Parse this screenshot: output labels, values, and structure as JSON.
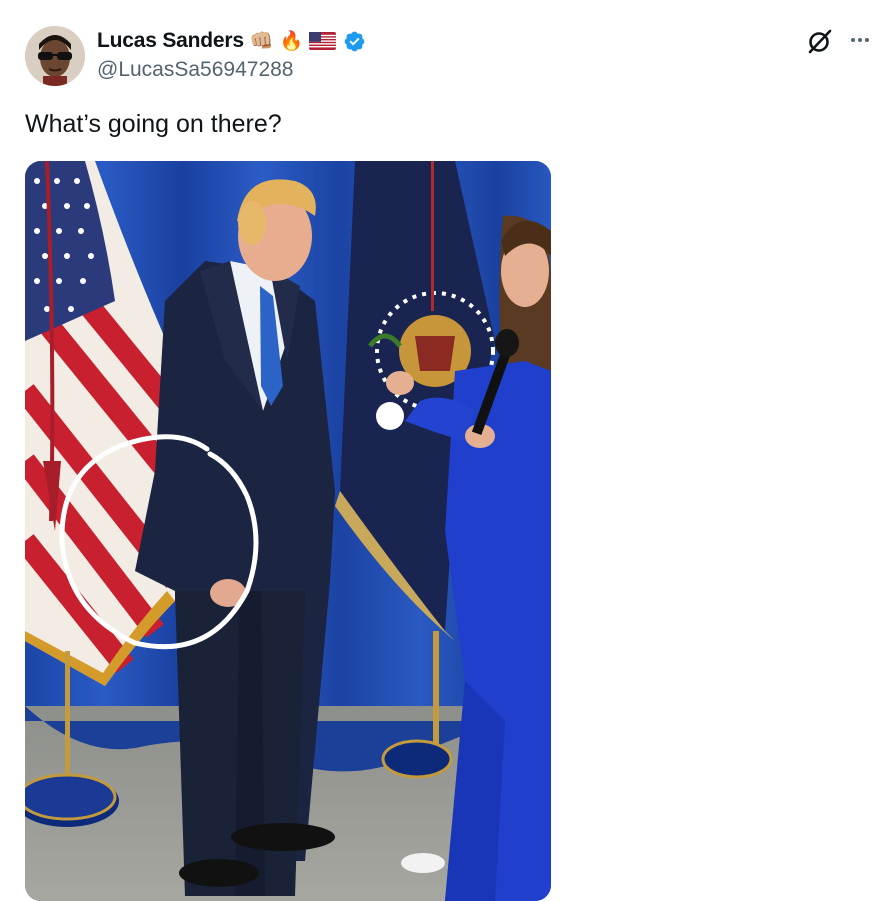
{
  "tweet": {
    "author": {
      "display_name": "Lucas Sanders",
      "name_emojis": [
        "👊🏼",
        "🔥"
      ],
      "flag": "us-flag",
      "verified": true,
      "handle": "@LucasSa56947288"
    },
    "text": "What’s going on there?",
    "media": {
      "type": "photo",
      "annotation": "white-circle-highlight"
    },
    "actions": {
      "grok_icon": "grok-icon",
      "more_icon": "more-icon"
    }
  },
  "colors": {
    "text_primary": "#0f1419",
    "text_secondary": "#536471",
    "verified_blue": "#1d9bf0",
    "curtain_blue": "#1e4ab0",
    "suit_navy": "#1b2440"
  }
}
